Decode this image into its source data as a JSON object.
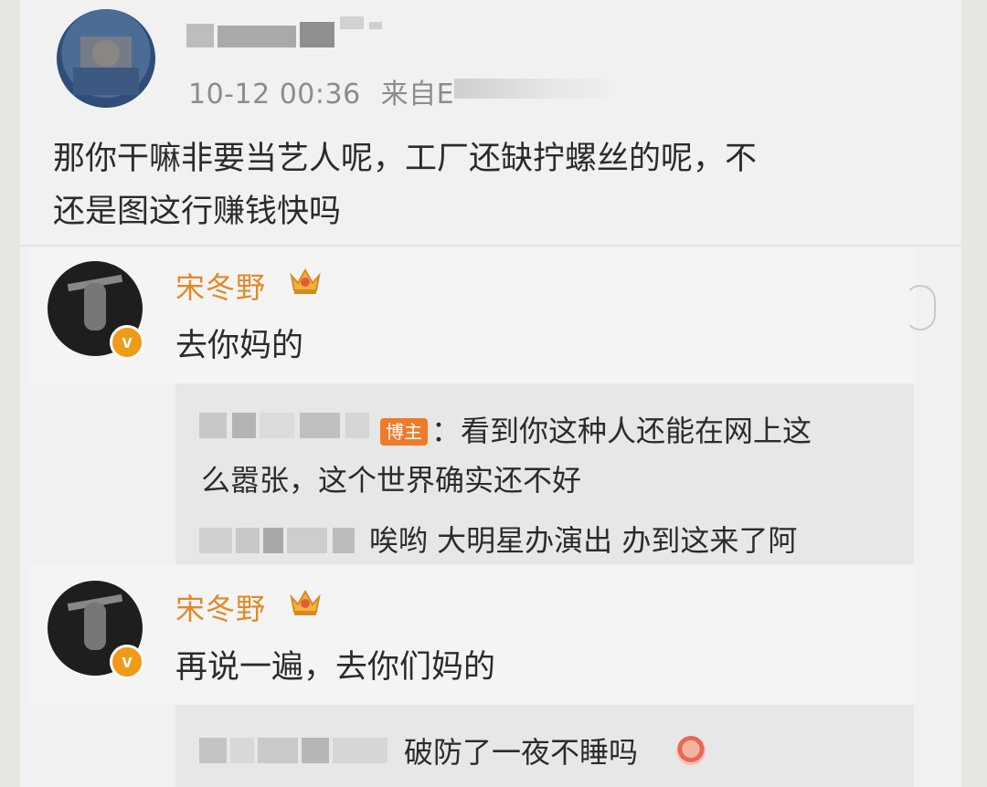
{
  "post": {
    "timestamp": "10-12 00:36",
    "source_prefix": "来自E",
    "text_line1": "那你干嘛非要当艺人呢，工厂还缺拧螺丝的呢，不",
    "text_line2": "还是图这行赚钱快吗"
  },
  "replies": [
    {
      "author": "宋冬野",
      "text": "去你妈的",
      "quoted": {
        "badge": "博主",
        "text_line1": "：看到你这种人还能在网上这",
        "text_line2": "么嚣张，这个世界确实还不好",
        "sub_text": "唉哟 大明星办演出 办到这来了阿"
      }
    },
    {
      "author": "宋冬野",
      "text": "再说一遍，去你们妈的",
      "quoted": {
        "text": "破防了一夜不睡吗"
      }
    }
  ],
  "verified_badge": "v",
  "colors": {
    "author": "#e0892a",
    "badge": "#f07a2a",
    "verified": "#f09a18"
  },
  "icons": [
    "crown-icon",
    "verified-icon",
    "laugh-emoji-icon"
  ]
}
